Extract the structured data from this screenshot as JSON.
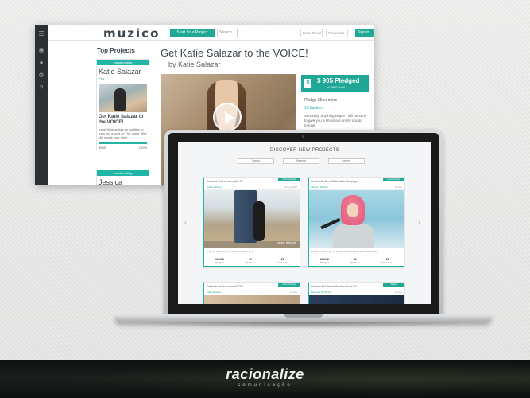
{
  "desktop": {
    "logo": "muzico",
    "start_button": "Start Your Project",
    "search_placeholder": "Search",
    "email_placeholder": "Enter Email",
    "password_placeholder": "Password",
    "signin_button": "Sign in",
    "top_projects_title": "Top Projects",
    "card1": {
      "tag": "crowdfunding",
      "name": "Katie Salazar",
      "follow": "Pop",
      "title": "Get Katie Salazar to the VOICE!",
      "desc": "Katie Salazar has an audition to earn her a spot on The Voice. She still needs your help!",
      "amount": "$905",
      "percent": "100%",
      "progress": 1.0
    },
    "card2": {
      "tag": "crowdfunding",
      "name": "Jessica ZenZen"
    },
    "main_title": "Get Katie Salazar to the VOICE!",
    "main_sub": "by Katie Salazar",
    "pledge": {
      "amount": "$ 905 Pledged",
      "goal": "of $900 Goal",
      "pledge_line": "Pledge $5 or more",
      "backers": "10 backers",
      "desc": "Seriously, anything helps! I will be sure to give you a shout out on my social media!"
    }
  },
  "laptop": {
    "title": "DISCOVER NEW PROJECTS",
    "filters": [
      "Status",
      "Nearest",
      "genre"
    ],
    "nav_prev": "‹",
    "nav_next": "›",
    "card1": {
      "title": "Knockout Kelly's \"Homegirls\" EP",
      "artist": "Casar Beluory",
      "date": "23 Aug 2017",
      "badge": "crowdfunding",
      "caption": "cesar beluory",
      "desc": "Help me afford my new EP \"Homegirls\" by Q",
      "stats": [
        {
          "value": "1025 $",
          "label": "Pledged"
        },
        {
          "value": "11",
          "label": "Backers"
        },
        {
          "value": "28",
          "label": "Days to Go"
        }
      ]
    },
    "card2": {
      "title": "Jessica ZenZen Official Music Campaign",
      "artist": "Jessica ZenZen",
      "date": "10 Aug",
      "badge": "crowdfunding",
      "desc": "Support and pledge to Jessica ZenZen Music Video Production",
      "stats": [
        {
          "value": "2321 $",
          "label": "Pledged"
        },
        {
          "value": "11",
          "label": "Backers"
        },
        {
          "value": "28",
          "label": "Days to Go"
        }
      ]
    },
    "card3": {
      "title": "Get Katie Salazar to the VOICE!",
      "artist": "Katie Salazar",
      "date": "10 Aug",
      "badge": "crowdfunding"
    },
    "card4": {
      "title": "Dayonte McClinton's Shadow Album CD",
      "artist": "Dayonte McClinton",
      "date": "10 Aug",
      "badge": "Single"
    }
  },
  "footer": {
    "brand": "racionalize",
    "sub": "comunicação"
  }
}
